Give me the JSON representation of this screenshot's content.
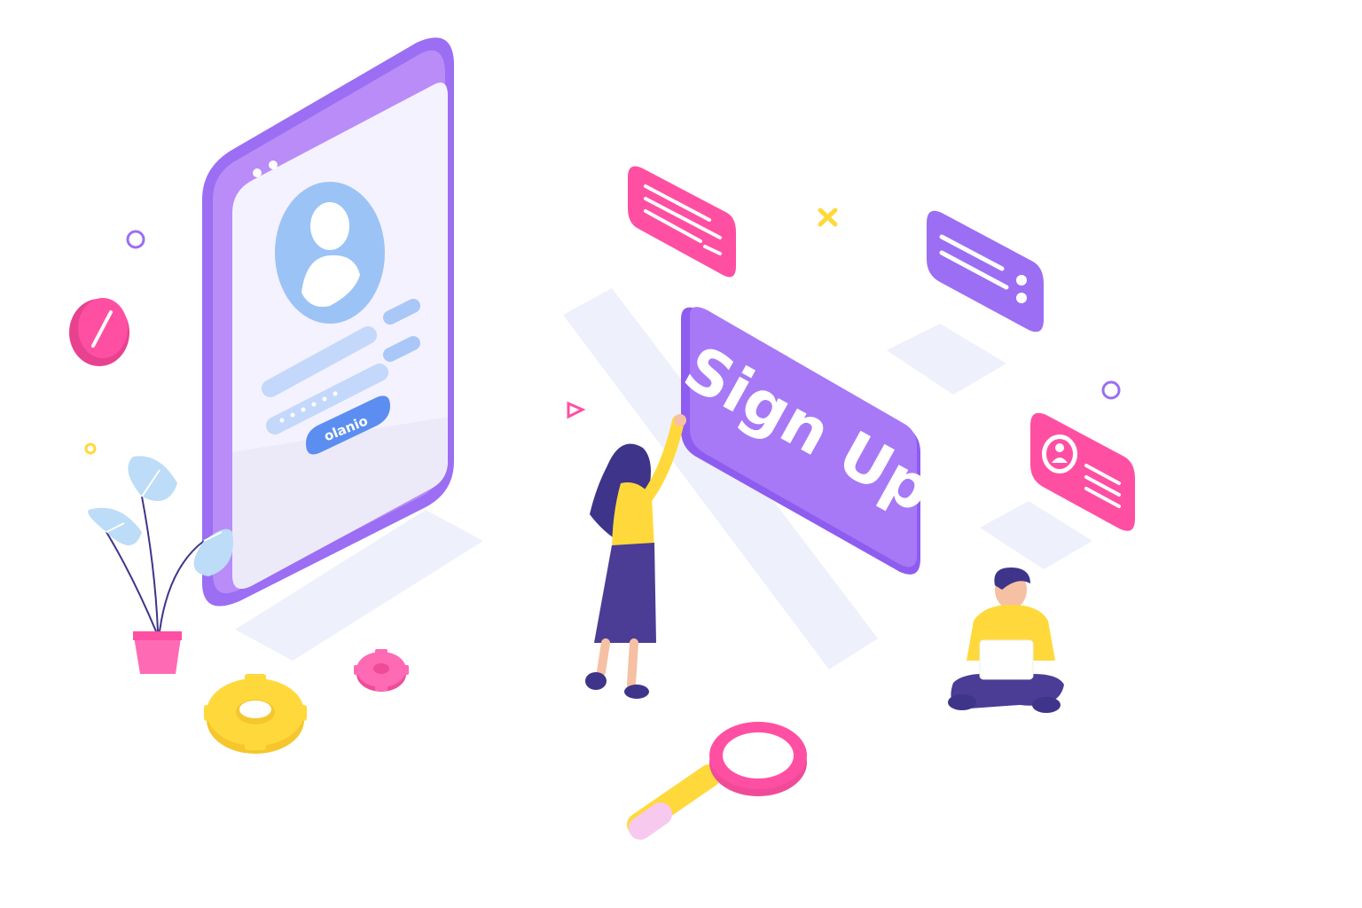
{
  "illustration": {
    "signup_label": "Sign Up",
    "phone_button_label": "olanio"
  },
  "colors": {
    "purple": "#9b6ef3",
    "purple_light": "#b98cf8",
    "pink": "#ff4fa3",
    "yellow": "#ffd93b",
    "blue_light": "#9cc3f5",
    "navy": "#3e3489"
  },
  "icons": [
    "user-avatar-icon",
    "gear-icon",
    "magnifier-icon",
    "plant-icon",
    "close-icon",
    "play-icon",
    "ring-icon"
  ]
}
